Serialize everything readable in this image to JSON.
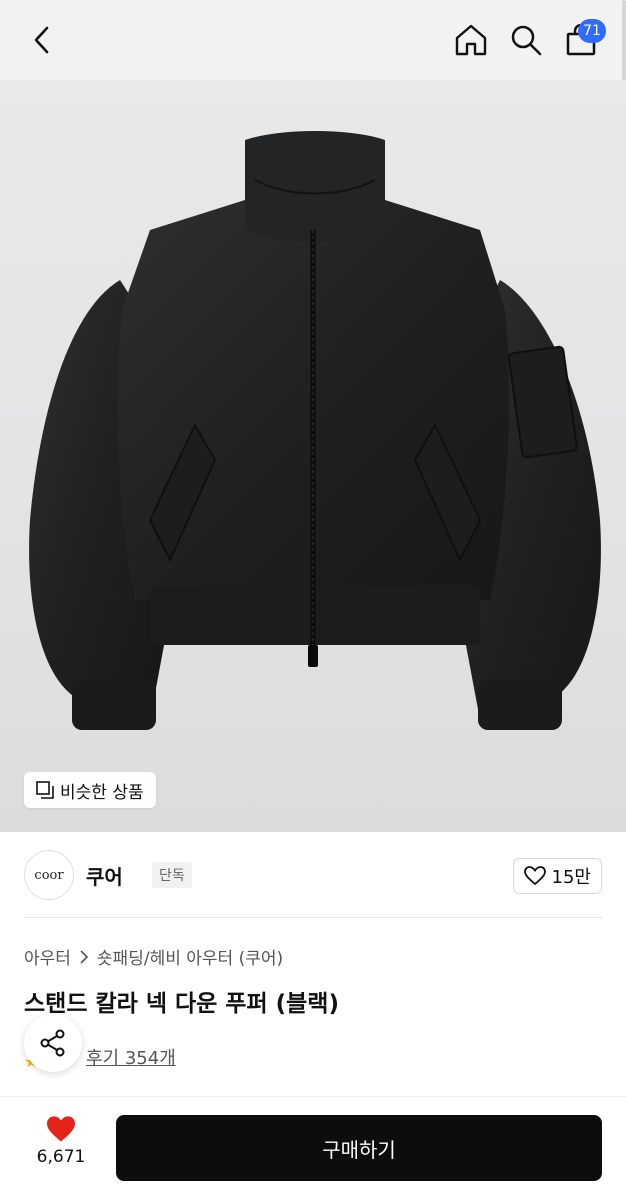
{
  "header": {
    "cart_count": "71"
  },
  "hero": {
    "similar_label": "비슷한 상품"
  },
  "brand": {
    "logo_text": "coor",
    "name": "쿠어",
    "badge": "단독",
    "like_count": "15만"
  },
  "product": {
    "breadcrumb": [
      "아우터",
      "숏패딩/헤비 아우터 (쿠어)"
    ],
    "title": "스탠드 칼라 넥 다운 푸퍼 (블랙)",
    "review_text": "후기 354개"
  },
  "bottom": {
    "wish_count": "6,671",
    "buy_label": "구매하기"
  },
  "colors": {
    "accent_badge": "#2f6bff",
    "heart": "#e5231b",
    "buy_button": "#0d0d0d"
  }
}
